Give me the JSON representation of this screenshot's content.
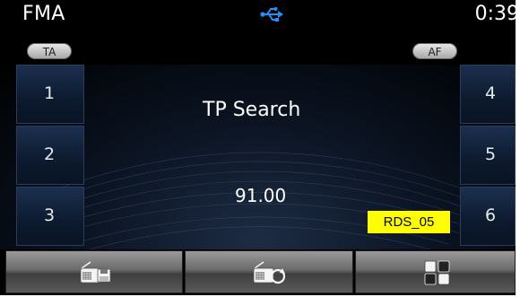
{
  "status_bar": {
    "band": "FMA",
    "time": "0:39",
    "usb_icon": "usb-icon"
  },
  "toggles": {
    "ta_label": "TA",
    "af_label": "AF"
  },
  "presets": [
    {
      "label": "1"
    },
    {
      "label": "2"
    },
    {
      "label": "3"
    },
    {
      "label": "4"
    },
    {
      "label": "5"
    },
    {
      "label": "6"
    }
  ],
  "main": {
    "status_text": "TP Search",
    "frequency": "91.00",
    "rds_label": "RDS_05"
  },
  "softkeys": [
    {
      "icon": "radio-save-icon"
    },
    {
      "icon": "radio-scan-icon"
    },
    {
      "icon": "menu-grid-icon"
    }
  ],
  "colors": {
    "rds_badge": "#ffff00",
    "usb_icon": "#1e90ff",
    "background": "#000000"
  }
}
